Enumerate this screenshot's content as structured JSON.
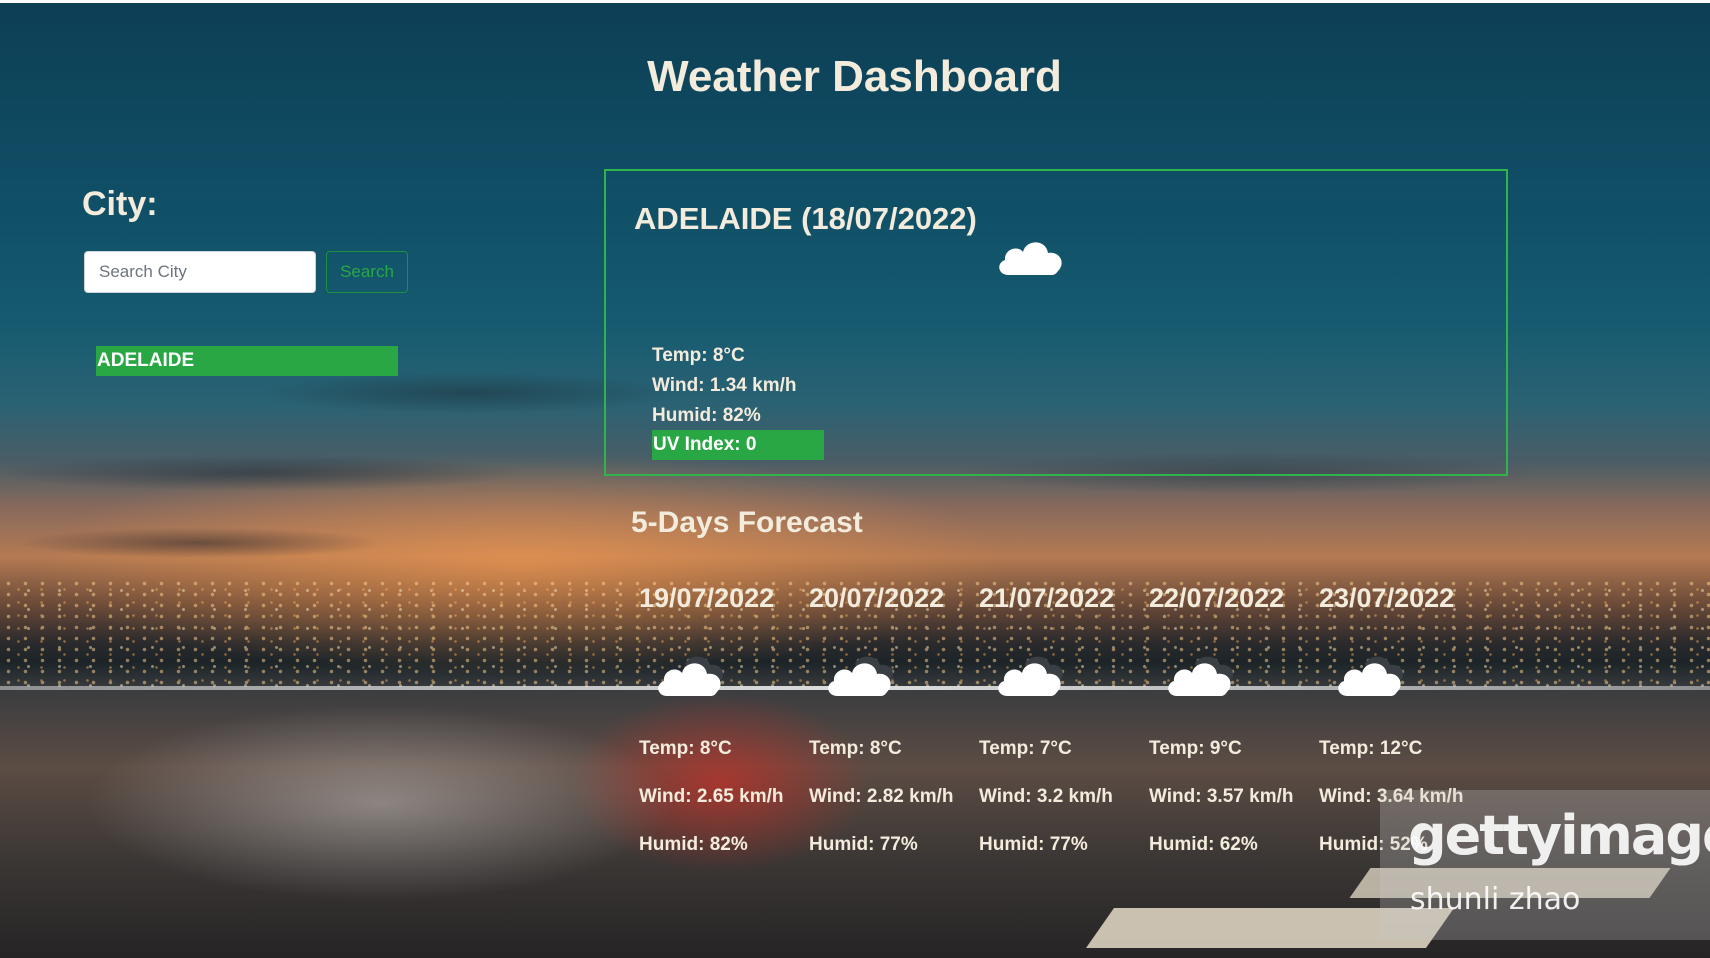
{
  "page": {
    "title": "Weather Dashboard"
  },
  "search": {
    "label": "City:",
    "placeholder": "Search City",
    "value": "",
    "button_label": "Search"
  },
  "history": [
    {
      "label": "ADELAIDE"
    }
  ],
  "current": {
    "title": "ADELAIDE (18/07/2022)",
    "icon": "cloud-icon",
    "temp": "Temp: 8°C",
    "wind": "Wind: 1.34 km/h",
    "humid": "Humid: 82%",
    "uv": "UV Index: 0",
    "uv_color": "#2aa745"
  },
  "forecast": {
    "title": "5-Days Forecast",
    "days": [
      {
        "date": "19/07/2022",
        "icon": "cloud-icon",
        "temp": "Temp: 8°C",
        "wind": "Wind: 2.65 km/h",
        "humid": "Humid: 82%"
      },
      {
        "date": "20/07/2022",
        "icon": "cloud-icon",
        "temp": "Temp: 8°C",
        "wind": "Wind: 2.82 km/h",
        "humid": "Humid: 77%"
      },
      {
        "date": "21/07/2022",
        "icon": "cloud-icon",
        "temp": "Temp: 7°C",
        "wind": "Wind: 3.2 km/h",
        "humid": "Humid: 77%"
      },
      {
        "date": "22/07/2022",
        "icon": "cloud-icon",
        "temp": "Temp: 9°C",
        "wind": "Wind: 3.57 km/h",
        "humid": "Humid: 62%"
      },
      {
        "date": "23/07/2022",
        "icon": "cloud-icon",
        "temp": "Temp: 12°C",
        "wind": "Wind: 3.64 km/h",
        "humid": "Humid: 52%"
      }
    ]
  },
  "watermark": {
    "brand": "gettyimages",
    "author": "shunli zhao"
  },
  "colors": {
    "accent_green": "#2aa745",
    "card_border": "#2fb34a",
    "text": "#f3ecdc"
  }
}
